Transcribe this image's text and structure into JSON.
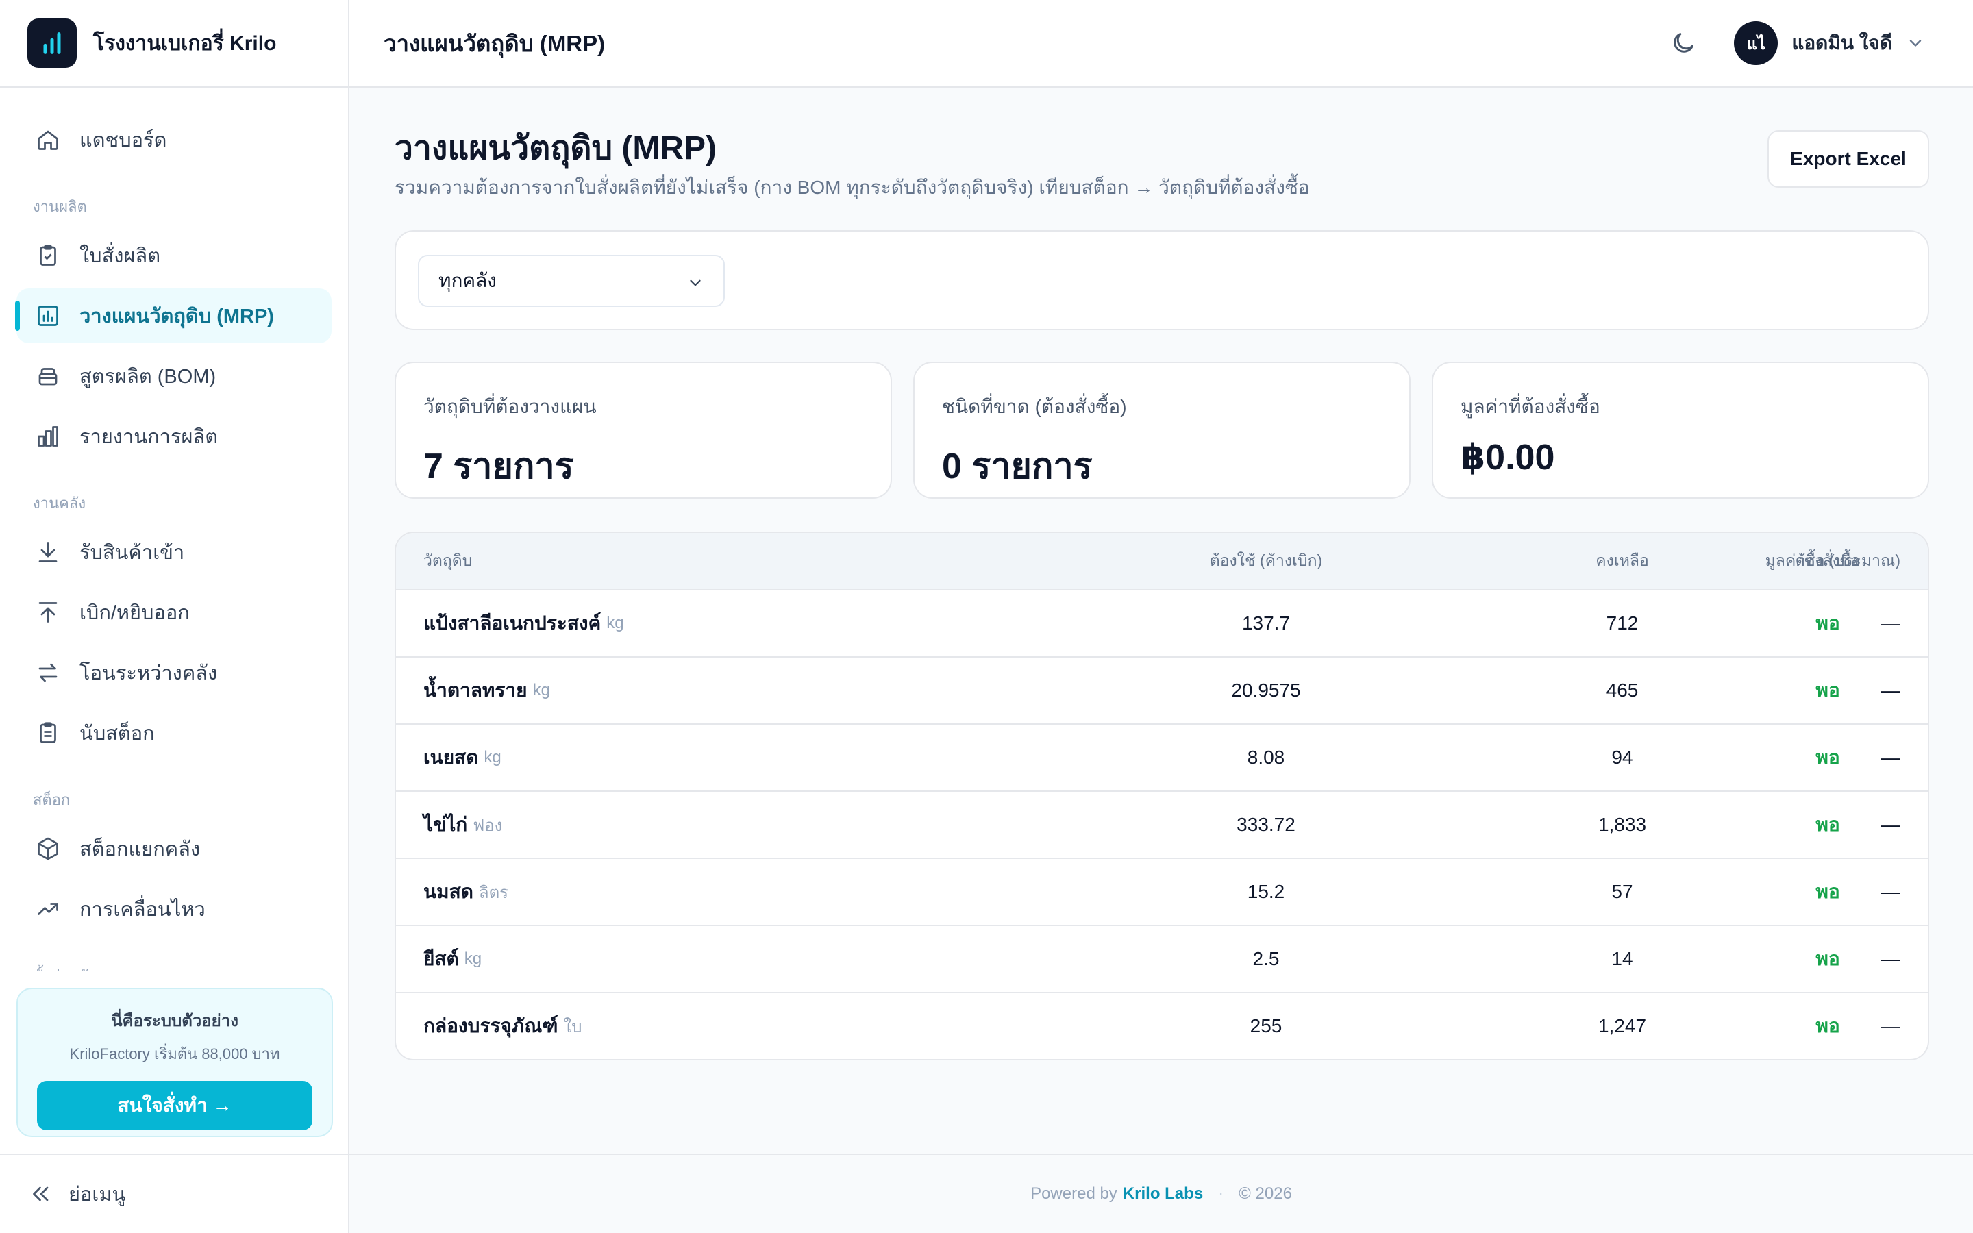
{
  "app": {
    "name": "โรงงานเบเกอรี่ Krilo"
  },
  "sidebar": {
    "items": [
      {
        "id": "dashboard",
        "label": "แดชบอร์ด",
        "icon": "home-icon"
      },
      {
        "section": "งานผลิต"
      },
      {
        "id": "orders",
        "label": "ใบสั่งผลิต",
        "icon": "clipboard-check-icon"
      },
      {
        "id": "mrp",
        "label": "วางแผนวัตถุดิบ (MRP)",
        "icon": "chart-box-icon",
        "active": true
      },
      {
        "id": "bom",
        "label": "สูตรผลิต (BOM)",
        "icon": "layers-icon"
      },
      {
        "id": "report",
        "label": "รายงานการผลิต",
        "icon": "bar-chart-icon"
      },
      {
        "section": "งานคลัง"
      },
      {
        "id": "receive",
        "label": "รับสินค้าเข้า",
        "icon": "download-icon"
      },
      {
        "id": "issue",
        "label": "เบิก/หยิบออก",
        "icon": "upload-icon"
      },
      {
        "id": "transfer",
        "label": "โอนระหว่างคลัง",
        "icon": "swap-icon"
      },
      {
        "id": "count",
        "label": "นับสต็อก",
        "icon": "clipboard-list-icon"
      },
      {
        "section": "สต็อก"
      },
      {
        "id": "stock",
        "label": "สต็อกแยกคลัง",
        "icon": "box-icon"
      },
      {
        "id": "movement",
        "label": "การเคลื่อนไหว",
        "icon": "trend-icon"
      },
      {
        "section": "ตั้งค่าคลัง",
        "clipped": true
      }
    ],
    "promo": {
      "title": "นี่คือระบบตัวอย่าง",
      "subtitle": "KriloFactory เริ่มต้น 88,000 บาท",
      "button": "สนใจสั่งทำ →"
    },
    "collapse_label": "ย่อเมนู"
  },
  "header": {
    "title": "วางแผนวัตถุดิบ (MRP)",
    "user_initials": "แไ",
    "user_name": "แอดมิน ใจดี"
  },
  "page": {
    "title": "วางแผนวัตถุดิบ (MRP)",
    "subtitle": "รวมความต้องการจากใบสั่งผลิตที่ยังไม่เสร็จ (กาง BOM ทุกระดับถึงวัตถุดิบจริง) เทียบสต็อก → วัตถุดิบที่ต้องสั่งซื้อ",
    "export_label": "Export Excel"
  },
  "filter": {
    "warehouse": "ทุกคลัง"
  },
  "stats": [
    {
      "label": "วัตถุดิบที่ต้องวางแผน",
      "value": "7 รายการ"
    },
    {
      "label": "ชนิดที่ขาด (ต้องสั่งซื้อ)",
      "value": "0 รายการ"
    },
    {
      "label": "มูลค่าที่ต้องสั่งซื้อ",
      "value": "฿0.00"
    }
  ],
  "table": {
    "headers": {
      "material": "วัตถุดิบ",
      "required": "ต้องใช้ (ค้างเบิก)",
      "remaining": "คงเหลือ",
      "to_order": "ต้องสั่งซื้อ",
      "cost": "มูลค่าซื้อ (ประมาณ)"
    },
    "rows": [
      {
        "name": "แป้งสาลีอเนกประสงค์",
        "unit": "kg",
        "required": "137.7",
        "remaining": "712",
        "status": "พอ",
        "cost": "—"
      },
      {
        "name": "น้ำตาลทราย",
        "unit": "kg",
        "required": "20.9575",
        "remaining": "465",
        "status": "พอ",
        "cost": "—"
      },
      {
        "name": "เนยสด",
        "unit": "kg",
        "required": "8.08",
        "remaining": "94",
        "status": "พอ",
        "cost": "—"
      },
      {
        "name": "ไข่ไก่",
        "unit": "ฟอง",
        "required": "333.72",
        "remaining": "1,833",
        "status": "พอ",
        "cost": "—"
      },
      {
        "name": "นมสด",
        "unit": "ลิตร",
        "required": "15.2",
        "remaining": "57",
        "status": "พอ",
        "cost": "—"
      },
      {
        "name": "ยีสต์",
        "unit": "kg",
        "required": "2.5",
        "remaining": "14",
        "status": "พอ",
        "cost": "—"
      },
      {
        "name": "กล่องบรรจุภัณฑ์",
        "unit": "ใบ",
        "required": "255",
        "remaining": "1,247",
        "status": "พอ",
        "cost": "—"
      }
    ]
  },
  "footer": {
    "powered": "Powered by",
    "brand": "Krilo Labs",
    "year": "© 2026"
  },
  "colors": {
    "accent": "#06b6d4",
    "ok": "#16a34a",
    "sidebar_active_bg": "#ecfbfe",
    "text": "#0f172a"
  }
}
